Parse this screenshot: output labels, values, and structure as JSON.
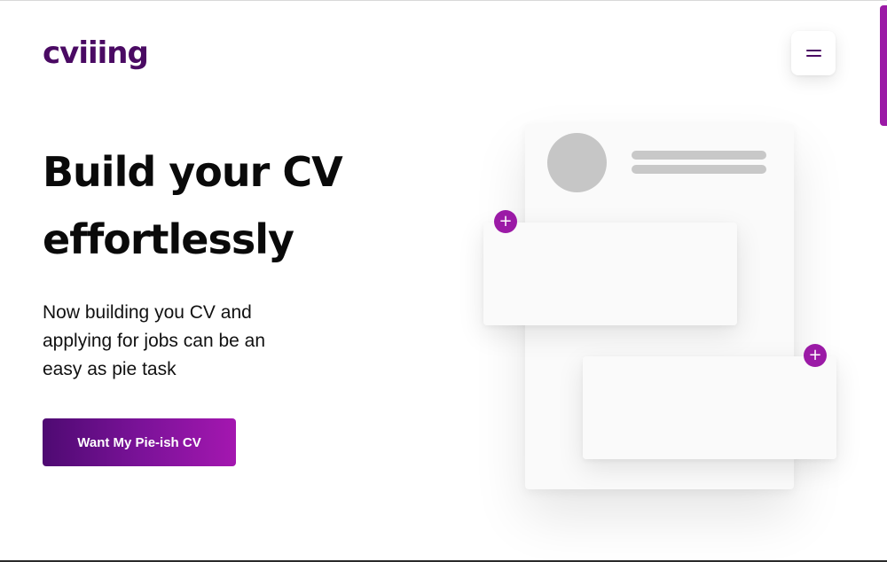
{
  "brand": {
    "logo_text": "cviiing",
    "accent_color": "#9b1aa6",
    "logo_color": "#4a0a63"
  },
  "header": {
    "menu_icon": "hamburger-menu-icon"
  },
  "hero": {
    "title_line1": "Build your CV",
    "title_line2": "effortlessly",
    "subtitle_line1": "Now building you CV and",
    "subtitle_line2": "applying for jobs can be an",
    "subtitle_line3": "easy as pie task",
    "cta_label": "Want My Pie-ish CV"
  },
  "illustration": {
    "plus_symbol": "+",
    "icons": [
      "add-section-icon",
      "add-section-icon"
    ]
  }
}
